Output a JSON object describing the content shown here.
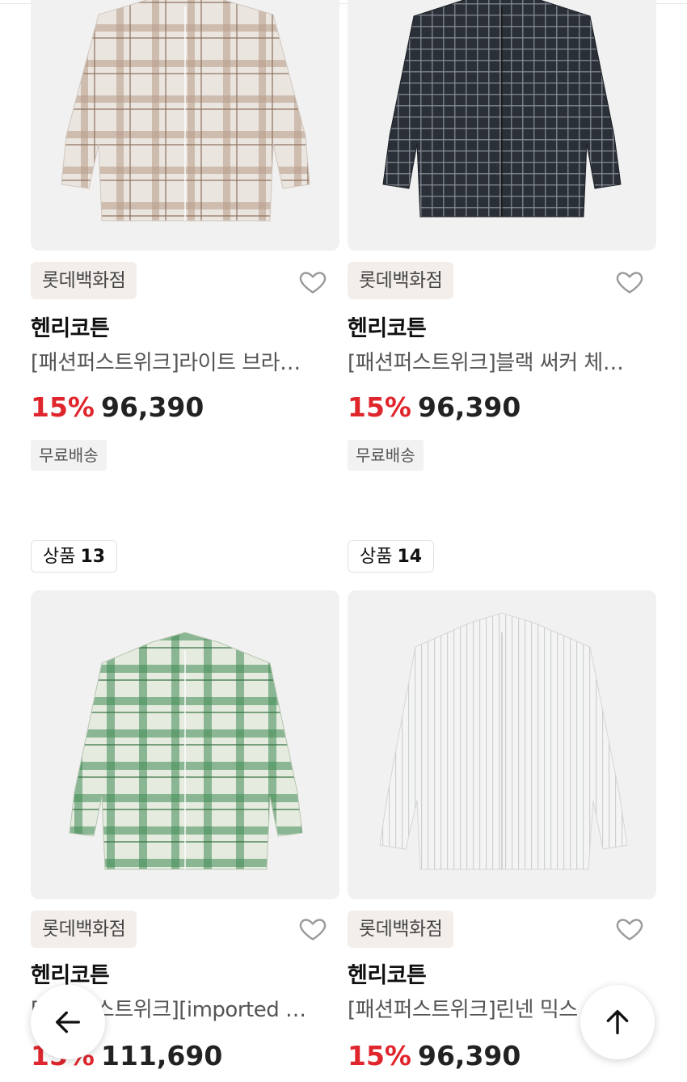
{
  "products": [
    {
      "rank_prefix": "",
      "rank_number": "",
      "store": "롯데백화점",
      "brand": "헨리코튼",
      "title": "[패션퍼스트위크]라이트 브라…",
      "discount": "15%",
      "price": "96,390",
      "shipping": "무료배송",
      "image": "beige-plaid-shirt",
      "colors": {
        "base": "#ebe5e0",
        "line": "#a88a72"
      }
    },
    {
      "rank_prefix": "",
      "rank_number": "",
      "store": "롯데백화점",
      "brand": "헨리코튼",
      "title": "[패션퍼스트위크]블랙 써커 체…",
      "discount": "15%",
      "price": "96,390",
      "shipping": "무료배송",
      "image": "black-check-shirt",
      "colors": {
        "base": "#2b3038",
        "line": "#8a9098"
      }
    },
    {
      "rank_prefix": "상품",
      "rank_number": "13",
      "store": "롯데백화점",
      "brand": "헨리코튼",
      "title": "[패션퍼스트위크][imported …",
      "discount": "15%",
      "price": "111,690",
      "shipping": "",
      "image": "green-plaid-shirt",
      "colors": {
        "base": "#e5ecdf",
        "line": "#3f8a53"
      }
    },
    {
      "rank_prefix": "상품",
      "rank_number": "14",
      "store": "롯데백화점",
      "brand": "헨리코튼",
      "title": "[패션퍼스트위크]린넨 믹스",
      "discount": "15%",
      "price": "96,390",
      "shipping": "",
      "image": "white-stripe-shirt",
      "colors": {
        "base": "#f4f4f4",
        "line": "#c9cccf"
      }
    }
  ],
  "nav": {
    "back_icon": "arrow-left-icon",
    "top_icon": "arrow-up-icon"
  }
}
